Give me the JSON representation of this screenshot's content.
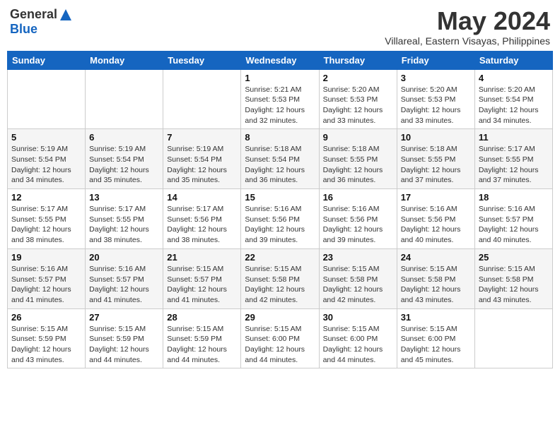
{
  "logo": {
    "general": "General",
    "blue": "Blue"
  },
  "title": {
    "month_year": "May 2024",
    "location": "Villareal, Eastern Visayas, Philippines"
  },
  "days_of_week": [
    "Sunday",
    "Monday",
    "Tuesday",
    "Wednesday",
    "Thursday",
    "Friday",
    "Saturday"
  ],
  "weeks": [
    [
      {
        "day": "",
        "info": ""
      },
      {
        "day": "",
        "info": ""
      },
      {
        "day": "",
        "info": ""
      },
      {
        "day": "1",
        "info": "Sunrise: 5:21 AM\nSunset: 5:53 PM\nDaylight: 12 hours\nand 32 minutes."
      },
      {
        "day": "2",
        "info": "Sunrise: 5:20 AM\nSunset: 5:53 PM\nDaylight: 12 hours\nand 33 minutes."
      },
      {
        "day": "3",
        "info": "Sunrise: 5:20 AM\nSunset: 5:53 PM\nDaylight: 12 hours\nand 33 minutes."
      },
      {
        "day": "4",
        "info": "Sunrise: 5:20 AM\nSunset: 5:54 PM\nDaylight: 12 hours\nand 34 minutes."
      }
    ],
    [
      {
        "day": "5",
        "info": "Sunrise: 5:19 AM\nSunset: 5:54 PM\nDaylight: 12 hours\nand 34 minutes."
      },
      {
        "day": "6",
        "info": "Sunrise: 5:19 AM\nSunset: 5:54 PM\nDaylight: 12 hours\nand 35 minutes."
      },
      {
        "day": "7",
        "info": "Sunrise: 5:19 AM\nSunset: 5:54 PM\nDaylight: 12 hours\nand 35 minutes."
      },
      {
        "day": "8",
        "info": "Sunrise: 5:18 AM\nSunset: 5:54 PM\nDaylight: 12 hours\nand 36 minutes."
      },
      {
        "day": "9",
        "info": "Sunrise: 5:18 AM\nSunset: 5:55 PM\nDaylight: 12 hours\nand 36 minutes."
      },
      {
        "day": "10",
        "info": "Sunrise: 5:18 AM\nSunset: 5:55 PM\nDaylight: 12 hours\nand 37 minutes."
      },
      {
        "day": "11",
        "info": "Sunrise: 5:17 AM\nSunset: 5:55 PM\nDaylight: 12 hours\nand 37 minutes."
      }
    ],
    [
      {
        "day": "12",
        "info": "Sunrise: 5:17 AM\nSunset: 5:55 PM\nDaylight: 12 hours\nand 38 minutes."
      },
      {
        "day": "13",
        "info": "Sunrise: 5:17 AM\nSunset: 5:55 PM\nDaylight: 12 hours\nand 38 minutes."
      },
      {
        "day": "14",
        "info": "Sunrise: 5:17 AM\nSunset: 5:56 PM\nDaylight: 12 hours\nand 38 minutes."
      },
      {
        "day": "15",
        "info": "Sunrise: 5:16 AM\nSunset: 5:56 PM\nDaylight: 12 hours\nand 39 minutes."
      },
      {
        "day": "16",
        "info": "Sunrise: 5:16 AM\nSunset: 5:56 PM\nDaylight: 12 hours\nand 39 minutes."
      },
      {
        "day": "17",
        "info": "Sunrise: 5:16 AM\nSunset: 5:56 PM\nDaylight: 12 hours\nand 40 minutes."
      },
      {
        "day": "18",
        "info": "Sunrise: 5:16 AM\nSunset: 5:57 PM\nDaylight: 12 hours\nand 40 minutes."
      }
    ],
    [
      {
        "day": "19",
        "info": "Sunrise: 5:16 AM\nSunset: 5:57 PM\nDaylight: 12 hours\nand 41 minutes."
      },
      {
        "day": "20",
        "info": "Sunrise: 5:16 AM\nSunset: 5:57 PM\nDaylight: 12 hours\nand 41 minutes."
      },
      {
        "day": "21",
        "info": "Sunrise: 5:15 AM\nSunset: 5:57 PM\nDaylight: 12 hours\nand 41 minutes."
      },
      {
        "day": "22",
        "info": "Sunrise: 5:15 AM\nSunset: 5:58 PM\nDaylight: 12 hours\nand 42 minutes."
      },
      {
        "day": "23",
        "info": "Sunrise: 5:15 AM\nSunset: 5:58 PM\nDaylight: 12 hours\nand 42 minutes."
      },
      {
        "day": "24",
        "info": "Sunrise: 5:15 AM\nSunset: 5:58 PM\nDaylight: 12 hours\nand 43 minutes."
      },
      {
        "day": "25",
        "info": "Sunrise: 5:15 AM\nSunset: 5:58 PM\nDaylight: 12 hours\nand 43 minutes."
      }
    ],
    [
      {
        "day": "26",
        "info": "Sunrise: 5:15 AM\nSunset: 5:59 PM\nDaylight: 12 hours\nand 43 minutes."
      },
      {
        "day": "27",
        "info": "Sunrise: 5:15 AM\nSunset: 5:59 PM\nDaylight: 12 hours\nand 44 minutes."
      },
      {
        "day": "28",
        "info": "Sunrise: 5:15 AM\nSunset: 5:59 PM\nDaylight: 12 hours\nand 44 minutes."
      },
      {
        "day": "29",
        "info": "Sunrise: 5:15 AM\nSunset: 6:00 PM\nDaylight: 12 hours\nand 44 minutes."
      },
      {
        "day": "30",
        "info": "Sunrise: 5:15 AM\nSunset: 6:00 PM\nDaylight: 12 hours\nand 44 minutes."
      },
      {
        "day": "31",
        "info": "Sunrise: 5:15 AM\nSunset: 6:00 PM\nDaylight: 12 hours\nand 45 minutes."
      },
      {
        "day": "",
        "info": ""
      }
    ]
  ]
}
